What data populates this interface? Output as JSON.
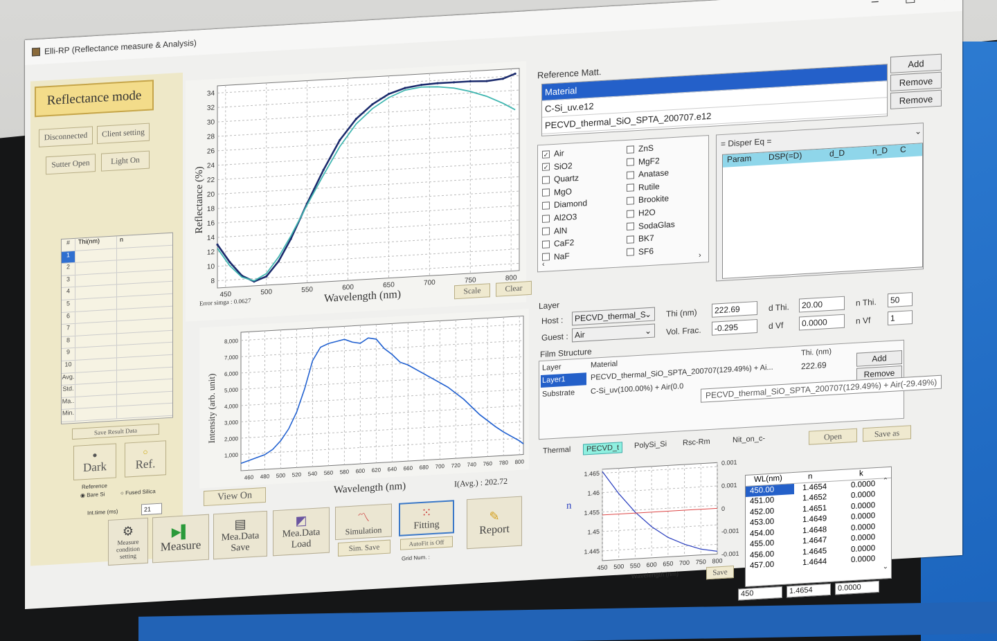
{
  "window": {
    "title": "Elli-RP (Reflectance measure & Analysis)",
    "minimize": "–",
    "maximize": "☐",
    "close": "✕"
  },
  "left": {
    "mode_label": "Reflectance mode",
    "disconnected": "Disconnected",
    "client_setting": "Client setting",
    "sutter_open": "Sutter Open",
    "light_on": "Light On",
    "table_headers": [
      "#",
      "Thi(nm)",
      "n"
    ],
    "table_rows": [
      "1",
      "2",
      "3",
      "4",
      "5",
      "6",
      "7",
      "8",
      "9",
      "10",
      "Avg.",
      "Std.",
      "Ma..",
      "Min."
    ],
    "save_result": "Save Result Data",
    "dark": "Dark",
    "ref": "Ref.",
    "reference_label": "Reference",
    "bare_si": "Bare Si",
    "fused_silica": "Fused Silica",
    "int_time_label": "Int.time (ms)",
    "int_time_value": "21"
  },
  "chart_refl": {
    "ylabel": "Reflectance (%)",
    "xlabel": "Wavelength (nm)",
    "yticks": [
      "34",
      "32",
      "30",
      "28",
      "26",
      "24",
      "22",
      "20",
      "18",
      "16",
      "14",
      "12",
      "10",
      "8"
    ],
    "xticks": [
      "450",
      "500",
      "550",
      "600",
      "650",
      "700",
      "750",
      "800"
    ],
    "error_sigma": "Error simga : 0.0627",
    "scale_btn": "Scale",
    "clear_btn": "Clear"
  },
  "chart_intensity": {
    "ylabel": "Intensity (arb. unit)",
    "xlabel": "Wavelength (nm)",
    "yticks": [
      "8,000",
      "7,000",
      "6,000",
      "5,000",
      "4,000",
      "3,000",
      "2,000",
      "1,000"
    ],
    "xticks": [
      "460",
      "480",
      "500",
      "520",
      "540",
      "560",
      "580",
      "600",
      "620",
      "640",
      "660",
      "680",
      "700",
      "720",
      "740",
      "760",
      "780",
      "800"
    ],
    "view_on": "View On",
    "iavg": "I(Avg.) : 202.72"
  },
  "chart_data": [
    {
      "type": "line",
      "xlabel": "Wavelength (nm)",
      "ylabel": "Reflectance (%)",
      "xlim": [
        440,
        810
      ],
      "ylim": [
        7,
        35
      ],
      "series": [
        {
          "x": [
            440,
            455,
            470,
            485,
            500,
            515,
            530,
            550,
            570,
            590,
            610,
            630,
            650,
            670,
            690,
            710,
            730,
            750,
            770,
            790,
            805
          ],
          "y": [
            13,
            10.5,
            8.5,
            7.6,
            8.2,
            10.2,
            13.2,
            18,
            22.5,
            26.5,
            29.3,
            31.2,
            32.5,
            33.2,
            33.5,
            33.6,
            33.6,
            33.6,
            33.5,
            33.7,
            34.3
          ]
        },
        {
          "x": [
            440,
            455,
            470,
            485,
            500,
            515,
            530,
            550,
            570,
            590,
            610,
            630,
            650,
            670,
            690,
            710,
            730,
            750,
            770,
            790,
            805
          ],
          "y": [
            12.5,
            10,
            8.3,
            7.7,
            8.6,
            10.8,
            13.6,
            17.8,
            21.8,
            25.6,
            28.6,
            30.6,
            32,
            32.9,
            33.2,
            33.1,
            32.8,
            32.2,
            31.4,
            30.3,
            29.3
          ]
        }
      ]
    },
    {
      "type": "line",
      "xlabel": "Wavelength (nm)",
      "ylabel": "Intensity (arb. unit)",
      "xlim": [
        450,
        805
      ],
      "ylim": [
        0,
        8500
      ],
      "series": [
        {
          "x": [
            450,
            460,
            470,
            480,
            490,
            500,
            510,
            520,
            530,
            540,
            550,
            560,
            570,
            580,
            590,
            600,
            610,
            620,
            630,
            640,
            650,
            660,
            670,
            680,
            690,
            700,
            710,
            720,
            730,
            740,
            750,
            760,
            770,
            780,
            790,
            800,
            805
          ],
          "y": [
            450,
            600,
            750,
            900,
            1200,
            1700,
            2400,
            3400,
            4800,
            6500,
            7300,
            7500,
            7600,
            7700,
            7500,
            7400,
            7700,
            7600,
            7000,
            6600,
            6100,
            5900,
            5600,
            5300,
            5000,
            4700,
            4400,
            4000,
            3600,
            3100,
            2600,
            2200,
            1800,
            1450,
            1150,
            850,
            650
          ]
        }
      ]
    },
    {
      "type": "line",
      "xlabel": "Wavelength (nm)",
      "ylabel": "n",
      "xlim": [
        450,
        800
      ],
      "ylim": [
        1.4425,
        1.466
      ],
      "series": [
        {
          "x": [
            450,
            500,
            550,
            600,
            650,
            700,
            750,
            800
          ],
          "y": [
            1.4654,
            1.4595,
            1.4545,
            1.4505,
            1.4475,
            1.4455,
            1.444,
            1.4432
          ]
        }
      ]
    }
  ],
  "buttons": {
    "measure_condition": "Measure condition setting",
    "measure": "Measure",
    "mea_data_save": "Mea.Data Save",
    "mea_data_load": "Mea.Data Load",
    "simulation": "Simulation",
    "sim_save": "Sim. Save",
    "fitting": "Fitting",
    "autofit": "AutoFit is Off",
    "grid_num": "Grid Num. :",
    "report": "Report"
  },
  "reference": {
    "title": "Reference Matt.",
    "materials": [
      "Material",
      "C-Si_uv.e12",
      "PECVD_thermal_SiO_SPTA_200707.e12"
    ],
    "add": "Add",
    "remove": "Remove",
    "checks_left": [
      {
        "label": "Air",
        "checked": true
      },
      {
        "label": "SiO2",
        "checked": true
      },
      {
        "label": "Quartz",
        "checked": false
      },
      {
        "label": "MgO",
        "checked": false
      },
      {
        "label": "Diamond",
        "checked": false
      },
      {
        "label": "Al2O3",
        "checked": false
      },
      {
        "label": "AlN",
        "checked": false
      },
      {
        "label": "CaF2",
        "checked": false
      },
      {
        "label": "NaF",
        "checked": false
      }
    ],
    "checks_right": [
      "ZnS",
      "MgF2",
      "Anatase",
      "Rutile",
      "Brookite",
      "H2O",
      "SodaGlas",
      "BK7",
      "SF6"
    ],
    "disper_eq": "= Disper Eq =",
    "param_headers": [
      "Param",
      "DSP(=D)",
      "d_D",
      "n_D",
      "C"
    ]
  },
  "layer": {
    "title": "Layer",
    "host_label": "Host :",
    "host_value": "PECVD_thermal_S",
    "guest_label": "Guest :",
    "guest_value": "Air",
    "thi_label": "Thi (nm)",
    "thi_value": "222.69",
    "dthi_label": "d Thi.",
    "dthi_value": "20.00",
    "nthi_label": "n Thi.",
    "nthi_value": "50",
    "volfrac_label": "Vol. Frac.",
    "volfrac_value": "-0.295",
    "dvf_label": "d Vf",
    "dvf_value": "0.0000",
    "nvf_label": "n Vf",
    "nvf_value": "1"
  },
  "film": {
    "title": "Film Structure",
    "headers": [
      "Layer",
      "Material",
      "Thi. (nm)"
    ],
    "layer1_name": "Layer1",
    "layer1_material": "PECVD_thermal_SiO_SPTA_200707(129.49%) + Ai...",
    "layer1_thi": "222.69",
    "substrate_name": "Substrate",
    "substrate_material": "C-Si_uv(100.00%) + Air(0.0",
    "tooltip": "PECVD_thermal_SiO_SPTA_200707(129.49%) + Air(-29.49%)",
    "add": "Add",
    "remove": "Remove"
  },
  "nk": {
    "tabs": [
      "Thermal",
      "PECVD_t",
      "PolySi_Si",
      "Rsc-Rm",
      "Nit_on_c-"
    ],
    "open": "Open",
    "save_as": "Save as",
    "save": "Save",
    "n_label": "n",
    "k_label": "k",
    "xlabel": "Wavelength (nm)",
    "n_ticks": [
      "1.465",
      "1.46",
      "1.455",
      "1.45",
      "1.445"
    ],
    "k_ticks": [
      "0.001",
      "0.001",
      "0",
      "-0.001",
      "-0.001"
    ],
    "x_ticks": [
      "450",
      "500",
      "550",
      "600",
      "650",
      "700",
      "750",
      "800"
    ],
    "table_headers": [
      "WL(nm)",
      "n",
      "k"
    ],
    "rows": [
      [
        "450.00",
        "1.4654",
        "0.0000"
      ],
      [
        "451.00",
        "1.4652",
        "0.0000"
      ],
      [
        "452.00",
        "1.4651",
        "0.0000"
      ],
      [
        "453.00",
        "1.4649",
        "0.0000"
      ],
      [
        "454.00",
        "1.4648",
        "0.0000"
      ],
      [
        "455.00",
        "1.4647",
        "0.0000"
      ],
      [
        "456.00",
        "1.4645",
        "0.0000"
      ],
      [
        "457.00",
        "1.4644",
        "0.0000"
      ]
    ],
    "edit_wl": "450",
    "edit_n": "1.4654",
    "edit_k": "0.0000"
  },
  "colors": {
    "measured": "#1a2a6c",
    "simulated": "#3fb6b0",
    "intensity": "#2060d0",
    "selection": "#2460c9",
    "mode_bg": "#f3dc8a"
  }
}
